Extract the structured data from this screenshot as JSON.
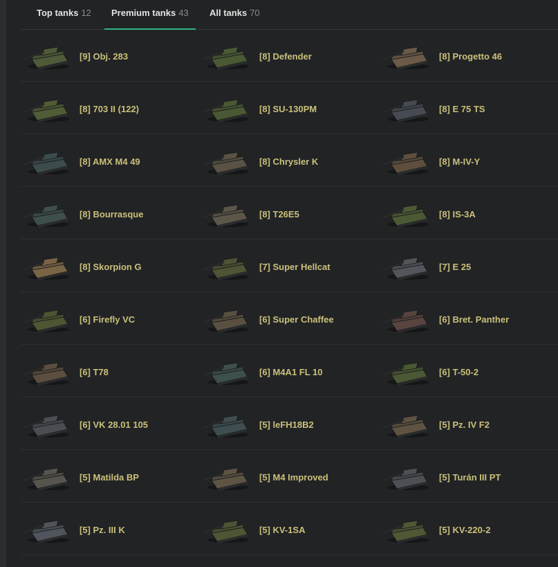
{
  "tabs": [
    {
      "label": "Top tanks",
      "count": "12"
    },
    {
      "label": "Premium tanks",
      "count": "43"
    },
    {
      "label": "All tanks",
      "count": "70"
    }
  ],
  "active_tab": "Premium tanks",
  "tanks": [
    [
      {
        "name": "[9] Obj. 283",
        "icon": "tank-icon",
        "color": "#4f5a38"
      },
      {
        "name": "[8] Defender",
        "icon": "tank-icon",
        "color": "#4a5a34"
      },
      {
        "name": "[8] Progetto 46",
        "icon": "tank-icon",
        "color": "#6b5a48"
      }
    ],
    [
      {
        "name": "[8] 703 II (122)",
        "icon": "tank-icon",
        "color": "#4f5c36"
      },
      {
        "name": "[8] SU-130PM",
        "icon": "tank-icon",
        "color": "#4a5834"
      },
      {
        "name": "[8] E 75 TS",
        "icon": "tank-icon",
        "color": "#464a52"
      }
    ],
    [
      {
        "name": "[8] AMX M4 49",
        "icon": "tank-icon",
        "color": "#3c4c4c"
      },
      {
        "name": "[8] Chrysler K",
        "icon": "tank-icon",
        "color": "#5a5244"
      },
      {
        "name": "[8] M-IV-Y",
        "icon": "tank-icon",
        "color": "#5e4e3e"
      }
    ],
    [
      {
        "name": "[8] Bourrasque",
        "icon": "tank-icon",
        "color": "#3e4e4c"
      },
      {
        "name": "[8] T26E5",
        "icon": "tank-icon",
        "color": "#5c5648"
      },
      {
        "name": "[8] IS-3A",
        "icon": "tank-icon",
        "color": "#4c5a34"
      }
    ],
    [
      {
        "name": "[8] Skorpion G",
        "icon": "tank-icon",
        "color": "#7a6446"
      },
      {
        "name": "[7] Super Hellcat",
        "icon": "tank-icon",
        "color": "#4e5434"
      },
      {
        "name": "[7] E 25",
        "icon": "tank-icon",
        "color": "#52565a"
      }
    ],
    [
      {
        "name": "[6] Firefly VC",
        "icon": "tank-icon",
        "color": "#4c5632"
      },
      {
        "name": "[6] Super Chaffee",
        "icon": "tank-icon",
        "color": "#5a5042"
      },
      {
        "name": "[6] Bret. Panther",
        "icon": "tank-icon",
        "color": "#5a4440"
      }
    ],
    [
      {
        "name": "[6] T78",
        "icon": "tank-icon",
        "color": "#5c4e3e"
      },
      {
        "name": "[6] M4A1 FL 10",
        "icon": "tank-icon",
        "color": "#3e504e"
      },
      {
        "name": "[6] T-50-2",
        "icon": "tank-icon",
        "color": "#4a5834"
      }
    ],
    [
      {
        "name": "[6] VK 28.01 105",
        "icon": "tank-icon",
        "color": "#4a4e52"
      },
      {
        "name": "[5] leFH18B2",
        "icon": "tank-icon",
        "color": "#3e4e50"
      },
      {
        "name": "[5] Pz. IV F2",
        "icon": "tank-icon",
        "color": "#5e5242"
      }
    ],
    [
      {
        "name": "[5] Matilda BP",
        "icon": "tank-icon",
        "color": "#56544c"
      },
      {
        "name": "[5] M4 Improved",
        "icon": "tank-icon",
        "color": "#5e5444"
      },
      {
        "name": "[5] Turán III PT",
        "icon": "tank-icon",
        "color": "#4c5054"
      }
    ],
    [
      {
        "name": "[5] Pz. III K",
        "icon": "tank-icon",
        "color": "#50545c"
      },
      {
        "name": "[5] KV-1SA",
        "icon": "tank-icon",
        "color": "#4c5634"
      },
      {
        "name": "[5] KV-220-2",
        "icon": "tank-icon",
        "color": "#4e5834"
      }
    ]
  ],
  "colors": {
    "background": "#212325",
    "accent": "#2db77f",
    "tank_name": "#cbc07a",
    "tab_count": "#8a8d90"
  }
}
